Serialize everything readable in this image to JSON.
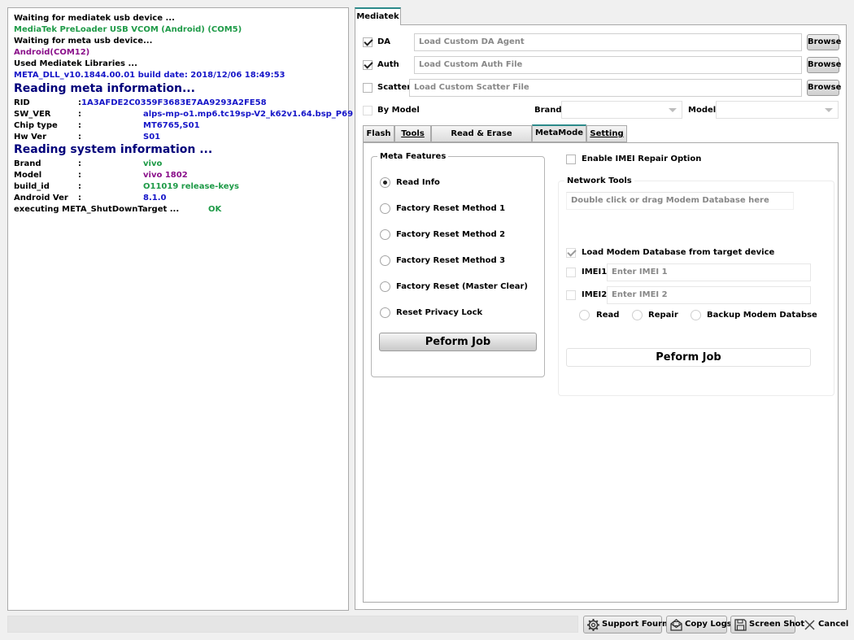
{
  "log": [
    {
      "text": "Waiting for mediatek usb device ...",
      "color": "#000000"
    },
    {
      "text": "MediaTek PreLoader USB VCOM (Android) (COM5)",
      "color": "#1e9a47"
    },
    {
      "text": "Waiting for meta usb device...",
      "color": "#000000"
    },
    {
      "text": "Android(COM12)",
      "color": "#8a0f8a"
    },
    {
      "text": "Used Mediatek Libraries ...",
      "color": "#000000"
    },
    {
      "text": "META_DLL_v10.1844.00.01 build date: 2018/12/06 18:49:53",
      "color": "#1515c8"
    }
  ],
  "meta_heading": "Reading meta information...",
  "meta_rows": [
    {
      "key": "RID",
      "sep": ":",
      "value": "1A3AFDE2C0359F3683E7AA9293A2FE58",
      "color": "#1515c8"
    },
    {
      "key": "SW_VER",
      "sep": ":",
      "value": "alps-mp-o1.mp6.tc19sp-V2_k62v1.64.bsp_P69",
      "color": "#1515c8"
    },
    {
      "key": "Chip type",
      "sep": ":",
      "value": "MT6765,S01",
      "color": "#1515c8"
    },
    {
      "key": "Hw Ver",
      "sep": ":",
      "value": "S01",
      "color": "#1515c8"
    }
  ],
  "system_heading": "Reading system information ...",
  "system_rows": [
    {
      "key": "Brand",
      "sep": ":",
      "value": "vivo",
      "color": "#1e9a47"
    },
    {
      "key": "Model",
      "sep": ":",
      "value": "vivo 1802",
      "color": "#8a0f8a"
    },
    {
      "key": "build_id",
      "sep": ":",
      "value": "O11019 release-keys",
      "color": "#1e9a47"
    },
    {
      "key": "Android Ver",
      "sep": ":",
      "value": "8.1.0",
      "color": "#1515c8"
    }
  ],
  "shutdown": {
    "text": "executing META_ShutDownTarget ...",
    "status": "OK",
    "status_color": "#1e9a47"
  },
  "main_tab": "Mediatek",
  "da": {
    "label": "DA",
    "checked": true,
    "placeholder": "Load Custom DA Agent",
    "browse": "Browse"
  },
  "auth": {
    "label": "Auth",
    "checked": true,
    "placeholder": "Load Custom Auth File",
    "browse": "Browse"
  },
  "scatter": {
    "label": "Scatter",
    "checked": false,
    "placeholder": "Load Custom Scatter File",
    "browse": "Browse"
  },
  "by_model": {
    "label": "By Model",
    "brand_label": "Brand",
    "model_label": "Model"
  },
  "subtabs": [
    {
      "label": "Flash",
      "active": false
    },
    {
      "label": "Tools",
      "active": false
    },
    {
      "label": "Read & Erase Operation",
      "active": false
    },
    {
      "label": "MetaMode",
      "active": true
    },
    {
      "label": "Setting",
      "active": false
    }
  ],
  "meta_features": {
    "title": "Meta Features",
    "options": [
      {
        "label": "Read Info",
        "selected": true
      },
      {
        "label": "Factory Reset Method 1",
        "selected": false
      },
      {
        "label": "Factory Reset Method 2",
        "selected": false
      },
      {
        "label": "Factory Reset Method 3",
        "selected": false
      },
      {
        "label": "Factory Reset (Master Clear)",
        "selected": false
      },
      {
        "label": "Reset Privacy Lock",
        "selected": false
      }
    ],
    "button": "Peform Job"
  },
  "imei_repair": {
    "label": "Enable IMEI Repair Option",
    "checked": false
  },
  "network_tools": {
    "title": "Network Tools",
    "drop_hint": "Double click or drag Modem Database  here",
    "load_from_target": "Load Modem Database from target device",
    "imei1": {
      "label": "IMEI1",
      "placeholder": "Enter IMEI 1"
    },
    "imei2": {
      "label": "IMEI2",
      "placeholder": "Enter IMEI 2"
    },
    "actions": [
      "Read",
      "Repair",
      "Backup Modem Databse"
    ],
    "button": "Peform Job"
  },
  "bottom": {
    "support": "Support Fourm",
    "copy_logs": "Copy Logs",
    "screenshot": "Screen Shot",
    "cancel": "Cancel"
  }
}
